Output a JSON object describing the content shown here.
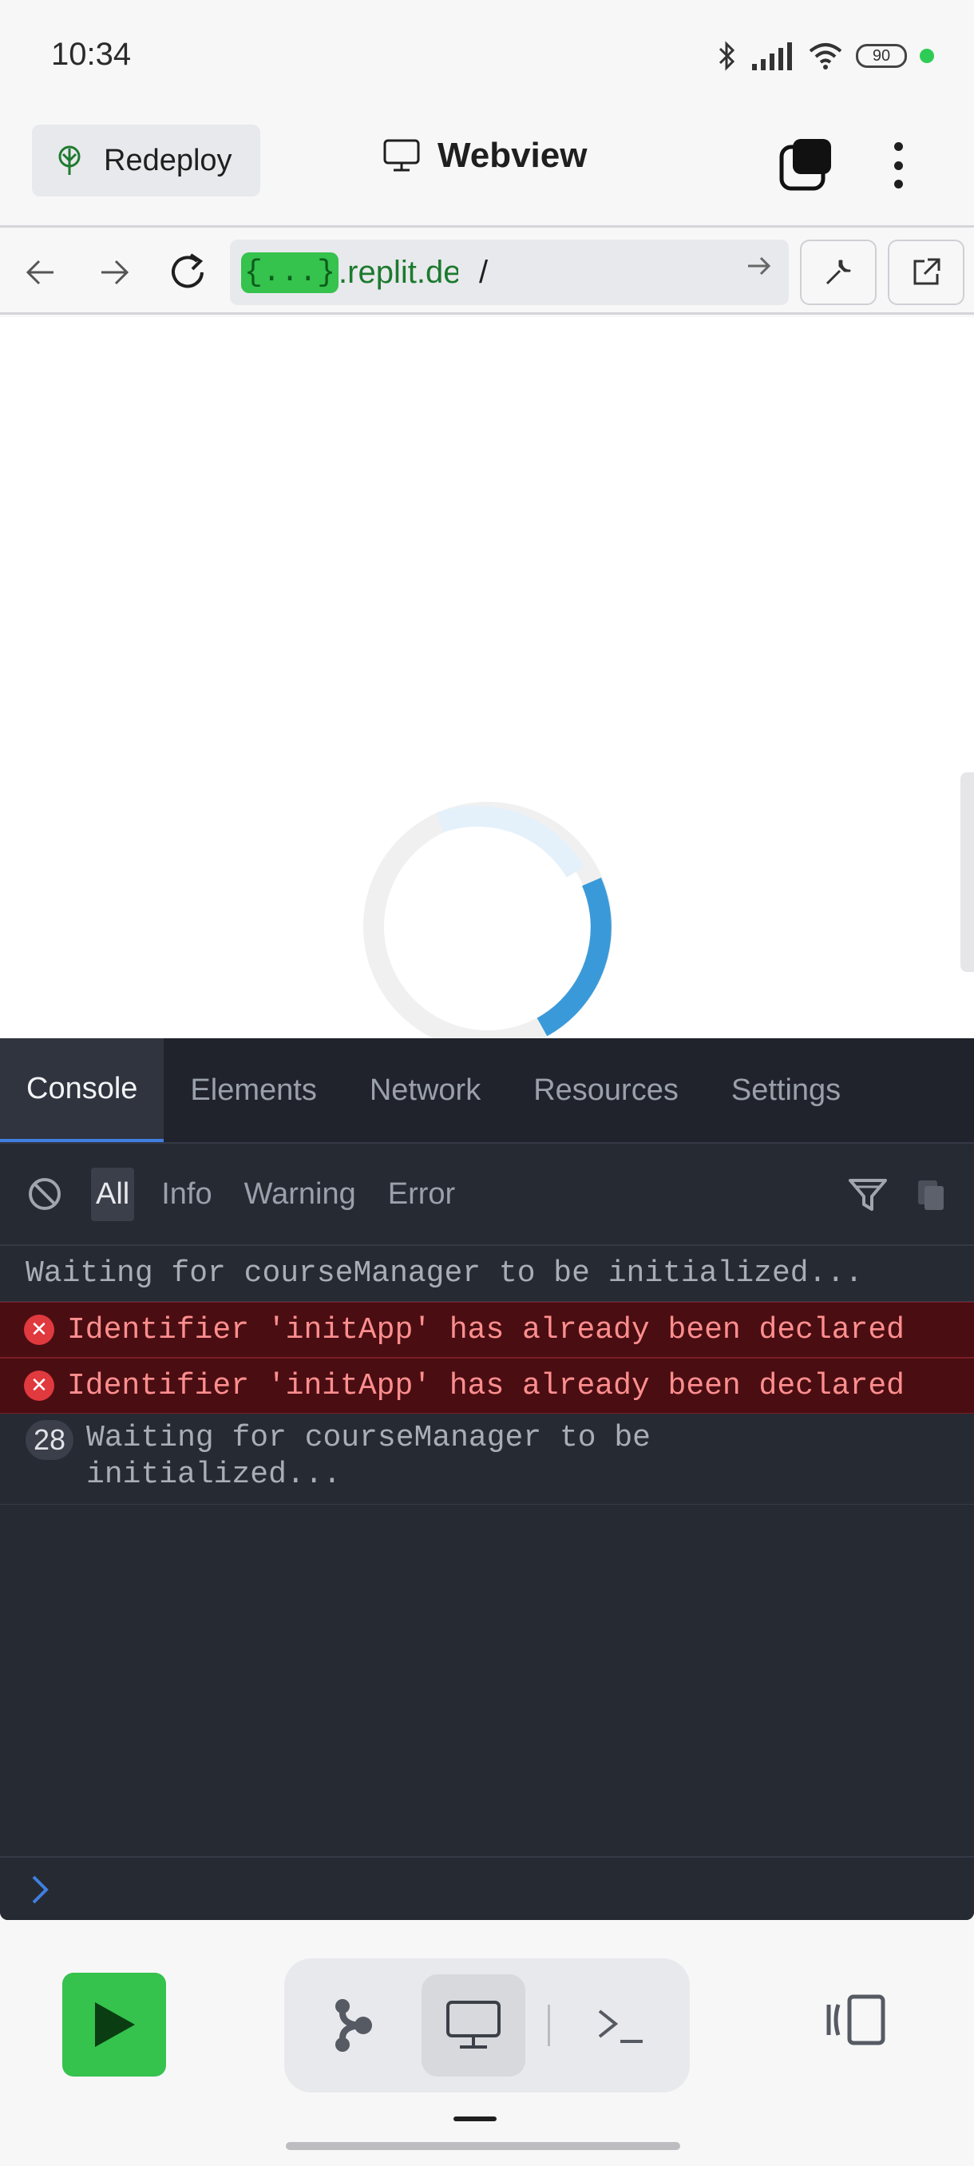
{
  "status_bar": {
    "time": "10:34",
    "battery": "90"
  },
  "header": {
    "redeploy_label": "Redeploy",
    "title": "Webview"
  },
  "urlbar": {
    "chip": "{...}",
    "host": ".replit.dev",
    "path": "/"
  },
  "devtools": {
    "tabs": [
      {
        "label": "Console"
      },
      {
        "label": "Elements"
      },
      {
        "label": "Network"
      },
      {
        "label": "Resources"
      },
      {
        "label": "Settings"
      }
    ],
    "filters": [
      {
        "label": "All"
      },
      {
        "label": "Info"
      },
      {
        "label": "Warning"
      },
      {
        "label": "Error"
      }
    ],
    "logs": [
      {
        "level": "info",
        "text": "Waiting for courseManager to be initialized..."
      },
      {
        "level": "error",
        "text": "Identifier 'initApp' has already been declared"
      },
      {
        "level": "error",
        "text": "Identifier 'initApp' has already been declared"
      },
      {
        "level": "info",
        "count": "28",
        "text": "Waiting for courseManager to be\ninitialized..."
      }
    ]
  },
  "colors": {
    "accent_green": "#35c24d",
    "error_background": "#4a0d12",
    "devtools_background": "#262a33",
    "spinner_blue": "#3a9ad9"
  }
}
